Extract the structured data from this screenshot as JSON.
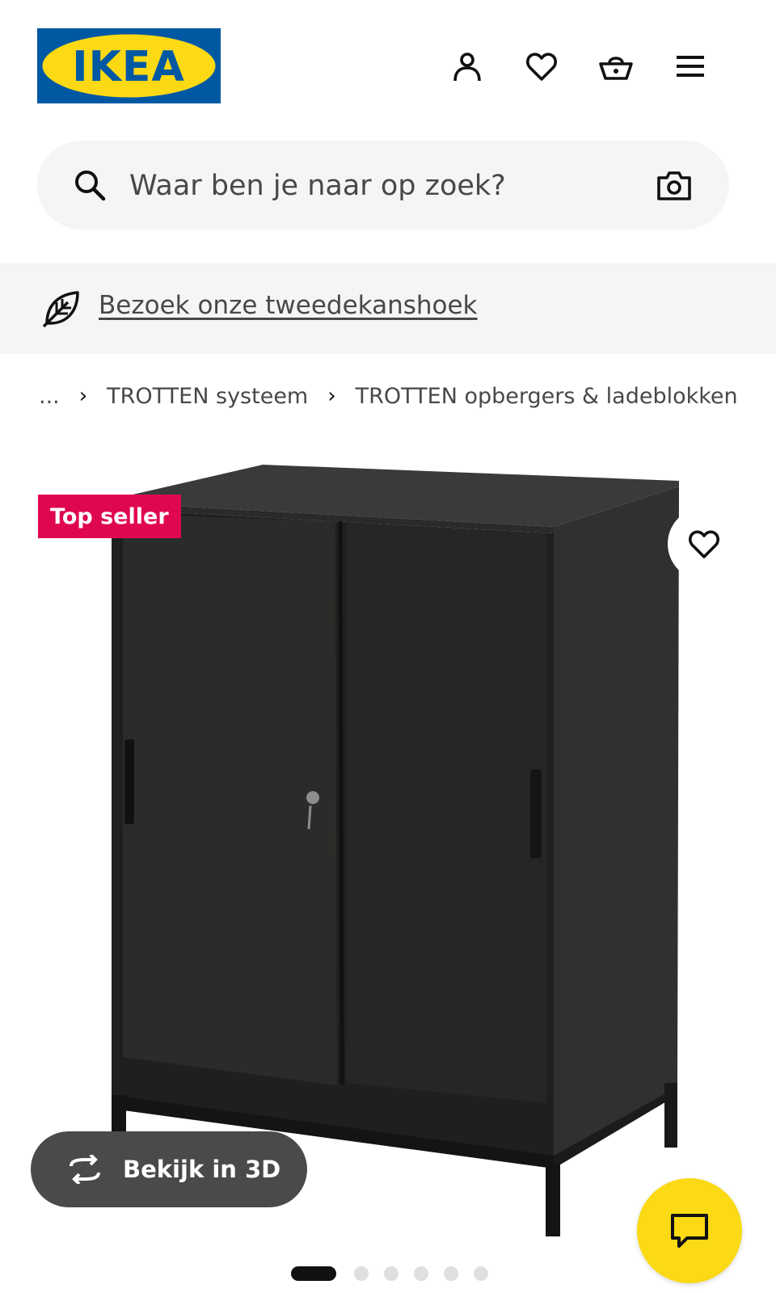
{
  "header": {
    "logo_text": "IKEA",
    "icons": [
      "user-icon",
      "heart-icon",
      "basket-icon",
      "menu-icon"
    ]
  },
  "search": {
    "placeholder": "Waar ben je naar op zoek?",
    "value": ""
  },
  "banner": {
    "link_text": "Bezoek onze tweedekanshoek"
  },
  "breadcrumb": {
    "ellipsis": "...",
    "items": [
      "TROTTEN systeem",
      "TROTTEN opbergers & ladeblokken"
    ]
  },
  "product": {
    "badge": "Top seller",
    "view_3d_label": "Bekijk in 3D",
    "gallery_count": 6,
    "gallery_active_index": 0
  },
  "colors": {
    "ikea_blue": "#0058a3",
    "ikea_yellow": "#fbd914",
    "badge_red": "#e00751"
  }
}
